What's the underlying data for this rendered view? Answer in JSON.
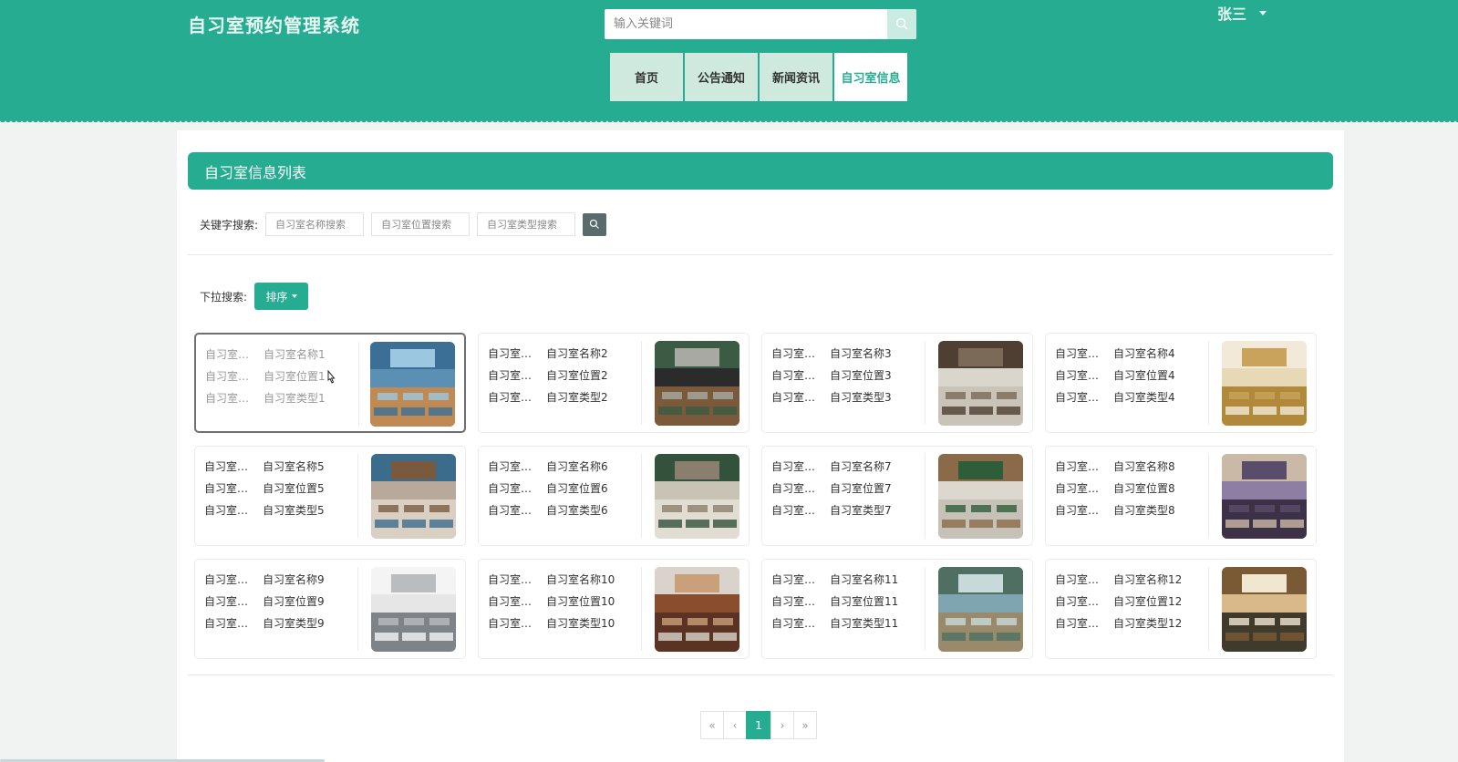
{
  "header": {
    "title": "自习室预约管理系统",
    "search_placeholder": "输入关键词",
    "user": "张三"
  },
  "nav": [
    {
      "label": "首页",
      "active": false
    },
    {
      "label": "公告通知",
      "active": false
    },
    {
      "label": "新闻资讯",
      "active": false
    },
    {
      "label": "自习室信息",
      "active": true
    }
  ],
  "list": {
    "title": "自习室信息列表",
    "keyword_label": "关键字搜索:",
    "keyword_placeholders": [
      "自习室名称搜索",
      "自习室位置搜索",
      "自习室类型搜索"
    ],
    "dropdown_label": "下拉搜索:",
    "sort_label": "排序"
  },
  "cards": [
    {
      "k": "自习室…",
      "name": "自习室名称1",
      "location": "自习室位置1",
      "type": "自习室类型1"
    },
    {
      "k": "自习室…",
      "name": "自习室名称2",
      "location": "自习室位置2",
      "type": "自习室类型2"
    },
    {
      "k": "自习室…",
      "name": "自习室名称3",
      "location": "自习室位置3",
      "type": "自习室类型3"
    },
    {
      "k": "自习室…",
      "name": "自习室名称4",
      "location": "自习室位置4",
      "type": "自习室类型4"
    },
    {
      "k": "自习室…",
      "name": "自习室名称5",
      "location": "自习室位置5",
      "type": "自习室类型5"
    },
    {
      "k": "自习室…",
      "name": "自习室名称6",
      "location": "自习室位置6",
      "type": "自习室类型6"
    },
    {
      "k": "自习室…",
      "name": "自习室名称7",
      "location": "自习室位置7",
      "type": "自习室类型7"
    },
    {
      "k": "自习室…",
      "name": "自习室名称8",
      "location": "自习室位置8",
      "type": "自习室类型8"
    },
    {
      "k": "自习室…",
      "name": "自习室名称9",
      "location": "自习室位置9",
      "type": "自习室类型9"
    },
    {
      "k": "自习室…",
      "name": "自习室名称10",
      "location": "自习室位置10",
      "type": "自习室类型10"
    },
    {
      "k": "自习室…",
      "name": "自习室名称11",
      "location": "自习室位置11",
      "type": "自习室类型11"
    },
    {
      "k": "自习室…",
      "name": "自习室名称12",
      "location": "自习室位置12",
      "type": "自习室类型12"
    }
  ],
  "pagination": {
    "first": "«",
    "prev": "‹",
    "current": "1",
    "next": "›",
    "last": "»"
  },
  "colors": {
    "accent": "#26ad91",
    "nav_bg": "#cfe9df"
  }
}
